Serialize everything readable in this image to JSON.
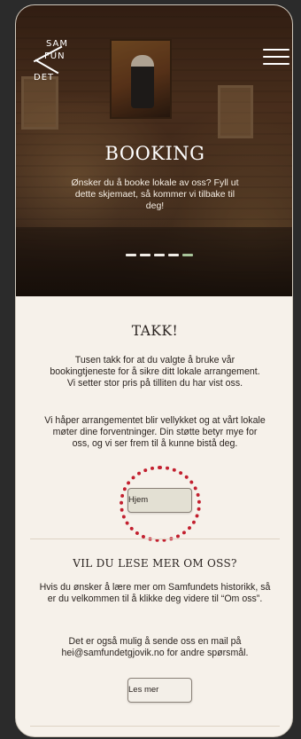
{
  "hero": {
    "logo_letters": [
      "SAM",
      "FUN",
      "DET"
    ],
    "title": "BOOKING",
    "subtitle": "Ønsker du å booke lokale av oss? Fyll ut dette skjemaet, så kommer vi tilbake til deg!",
    "slides_total": 5,
    "active_slide": 5
  },
  "thanks": {
    "title": "TAKK!",
    "paragraph1": "Tusen takk for at du valgte å bruke vår bookingtjeneste for å sikre ditt lokale arrangement. Vi setter stor pris på tilliten du har vist oss.",
    "paragraph2": "Vi håper arrangementet blir vellykket og at vårt lokale møter dine forventninger. Din støtte betyr mye for oss, og vi ser frem til å kunne bistå deg.",
    "home_button": "Hjem"
  },
  "about": {
    "title": "VIL DU LESE MER OM OSS?",
    "paragraph1": "Hvis du ønsker å lære mer om Samfundets historikk, så er du velkommen til å klikke deg videre til “Om oss”.",
    "paragraph2": "Det er også mulig å sende oss en mail på hei@samfundetgjovik.no for andre spørsmål.",
    "more_button": "Les mer"
  },
  "colors": {
    "background": "#2b2b2b",
    "page": "#f6f1ea",
    "accent_dot": "#a8c49a",
    "highlight_ring": "#c2202f"
  }
}
